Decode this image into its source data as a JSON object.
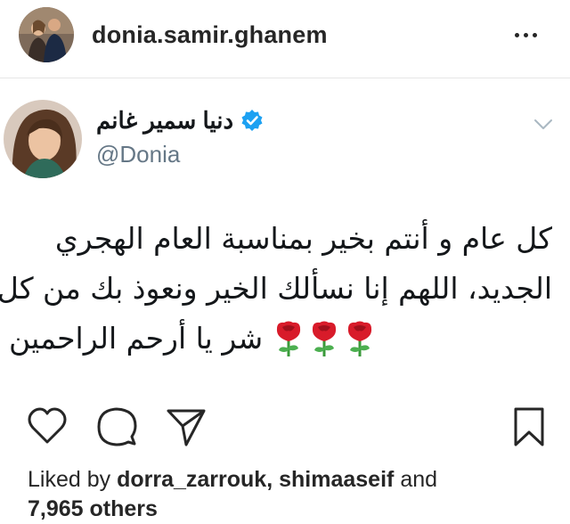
{
  "post": {
    "username": "donia.samir.ghanem",
    "more_icon": "more-horizontal-icon"
  },
  "tweet": {
    "display_name": "دنيا سمير غانم",
    "handle": "@Donia",
    "verified": true,
    "verified_color": "#1da1f2",
    "lines": [
      "كل عام و أنتم بخير بمناسبة العام الهجري",
      "الجديد، اللهم إنا نسألك الخير ونعوذ بك من كل",
      "شر يا أرحم الراحمين"
    ],
    "emoji": "rose-icon",
    "emoji_count": 3
  },
  "actions": {
    "like": "heart-icon",
    "comment": "comment-icon",
    "share": "send-icon",
    "save": "bookmark-icon"
  },
  "likes": {
    "prefix": "Liked by",
    "user1": "dorra_zarrouk",
    "separator": ",",
    "user2": "shimaaseif",
    "conjunction": "and",
    "others": "7,965 others"
  }
}
